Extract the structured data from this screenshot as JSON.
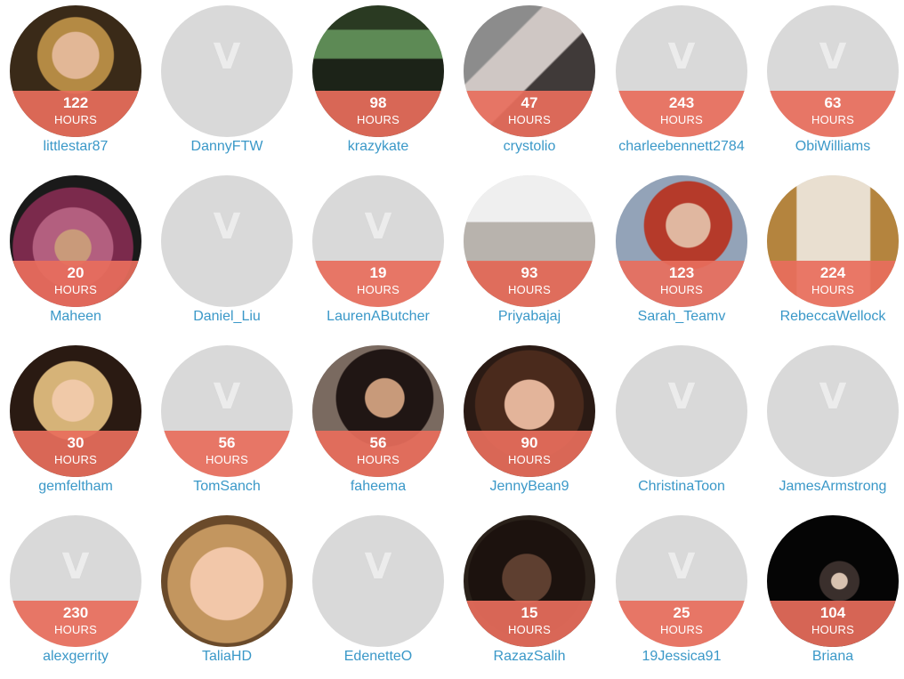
{
  "labels": {
    "hours": "HOURS"
  },
  "logo": "V",
  "profiles": [
    {
      "username": "littlestar87",
      "hours": "122",
      "photo": "p-blonde"
    },
    {
      "username": "DannyFTW",
      "hours": "",
      "photo": ""
    },
    {
      "username": "krazykate",
      "hours": "98",
      "photo": "p-green"
    },
    {
      "username": "crystolio",
      "hours": "47",
      "photo": "p-group"
    },
    {
      "username": "charleebennett2784",
      "hours": "243",
      "photo": ""
    },
    {
      "username": "ObiWilliams",
      "hours": "63",
      "photo": ""
    },
    {
      "username": "Maheen",
      "hours": "20",
      "photo": "p-scarf"
    },
    {
      "username": "Daniel_Liu",
      "hours": "",
      "photo": ""
    },
    {
      "username": "LaurenAButcher",
      "hours": "19",
      "photo": ""
    },
    {
      "username": "Priyabajaj",
      "hours": "93",
      "photo": "p-street"
    },
    {
      "username": "Sarah_Teamv",
      "hours": "123",
      "photo": "p-redhair"
    },
    {
      "username": "RebeccaWellock",
      "hours": "224",
      "photo": "p-curtain"
    },
    {
      "username": "gemfeltham",
      "hours": "30",
      "photo": "p-blonde2"
    },
    {
      "username": "TomSanch",
      "hours": "56",
      "photo": ""
    },
    {
      "username": "faheema",
      "hours": "56",
      "photo": "p-sofa"
    },
    {
      "username": "JennyBean9",
      "hours": "90",
      "photo": "p-brunette"
    },
    {
      "username": "ChristinaToon",
      "hours": "",
      "photo": ""
    },
    {
      "username": "JamesArmstrong",
      "hours": "",
      "photo": ""
    },
    {
      "username": "alexgerrity",
      "hours": "230",
      "photo": ""
    },
    {
      "username": "TaliaHD",
      "hours": "",
      "photo": "p-close"
    },
    {
      "username": "EdenetteO",
      "hours": "",
      "photo": ""
    },
    {
      "username": "RazazSalih",
      "hours": "15",
      "photo": "p-dark"
    },
    {
      "username": "19Jessica91",
      "hours": "25",
      "photo": ""
    },
    {
      "username": "Briana",
      "hours": "104",
      "photo": "p-night"
    }
  ]
}
